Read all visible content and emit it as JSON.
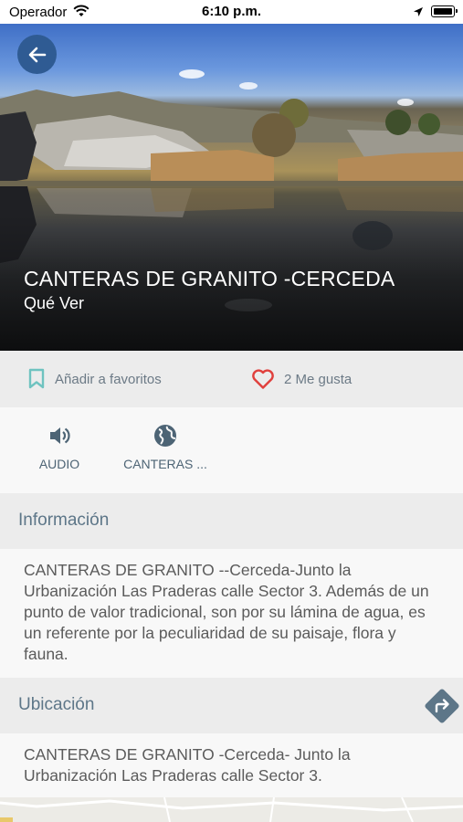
{
  "status_bar": {
    "carrier": "Operador",
    "time": "6:10 p.m.",
    "icons": [
      "wifi-icon",
      "location-arrow-icon",
      "battery-icon"
    ]
  },
  "hero": {
    "back_icon": "arrow-left-icon",
    "title": "CANTERAS DE GRANITO -CERCEDA",
    "subtitle": "Qué Ver"
  },
  "actions": {
    "favorites": {
      "label": "Añadir a favoritos",
      "icon": "bookmark-icon"
    },
    "likes": {
      "label": "2 Me gusta",
      "icon": "heart-icon"
    }
  },
  "media": [
    {
      "label": "AUDIO",
      "icon": "speaker-icon"
    },
    {
      "label": "CANTERAS ...",
      "icon": "globe-icon"
    }
  ],
  "information": {
    "header": "Información",
    "text": "CANTERAS DE GRANITO --Cerceda-Junto  la Urbanización Las Praderas calle Sector 3. Además de un punto de valor tradicional, son por su lámina de agua, es un referente por la peculiaridad de su paisaje, flora y fauna."
  },
  "location": {
    "header": "Ubicación",
    "directions_icon": "directions-icon",
    "text": "CANTERAS DE GRANITO -Cerceda- Junto  la Urbanización Las Praderas calle Sector 3."
  },
  "colors": {
    "accent_blue": "#2f5b93",
    "heart_red": "#e0403d",
    "bookmark_teal": "#6fc3c0",
    "section_text": "#5d7688"
  }
}
